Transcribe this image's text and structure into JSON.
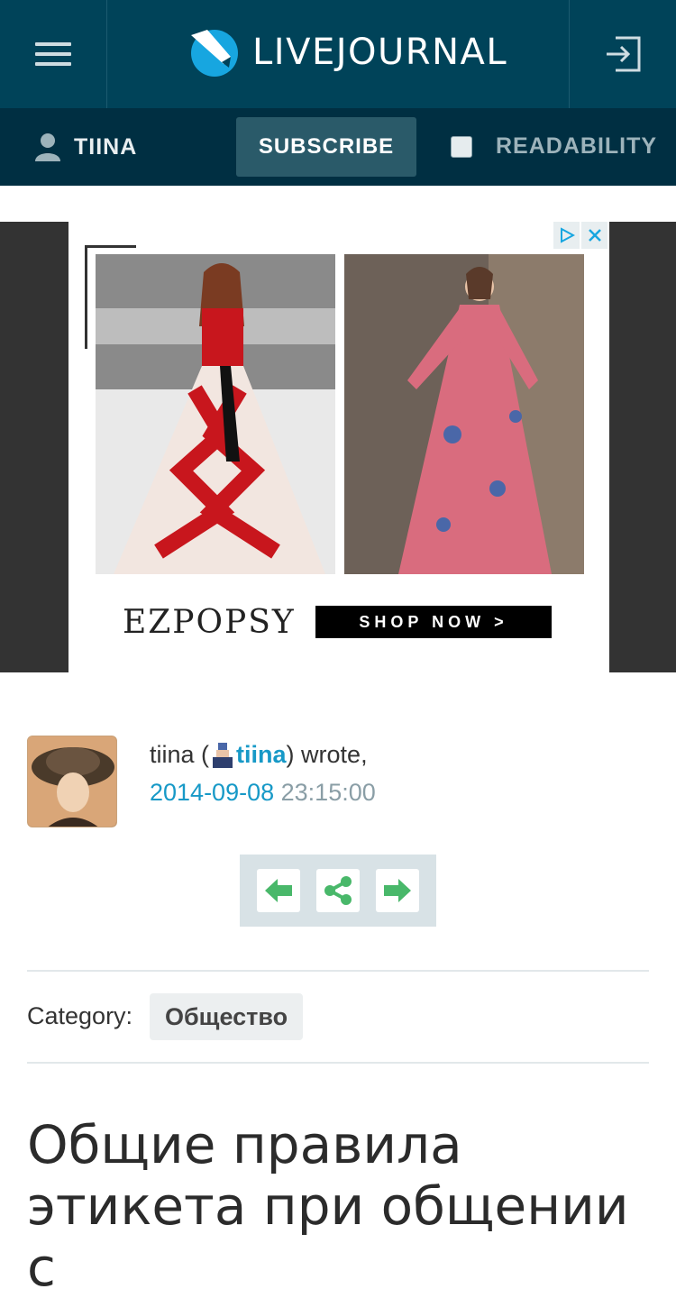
{
  "header": {
    "logo_text": "LIVEJOURNAL",
    "menu_icon": "hamburger-menu-icon",
    "login_icon": "login-icon"
  },
  "subbar": {
    "username": "TIINA",
    "subscribe_label": "SUBSCRIBE",
    "readability_label": "READABILITY",
    "readability_checked": false
  },
  "ad": {
    "brand": "EZPOPSY",
    "cta": "SHOP NOW  >"
  },
  "post": {
    "author_name": "tiina",
    "author_link": "tiina",
    "wrote": "wrote,",
    "date": "2014-09-08",
    "time": "23:15:00",
    "category_label": "Category:",
    "category_tag": "Общество",
    "title": "Общие правила этикета при общении с"
  },
  "colors": {
    "header_bg": "#004359",
    "subbar_bg": "#002f42",
    "link": "#1799c7",
    "control_arrow": "#49b86a"
  }
}
